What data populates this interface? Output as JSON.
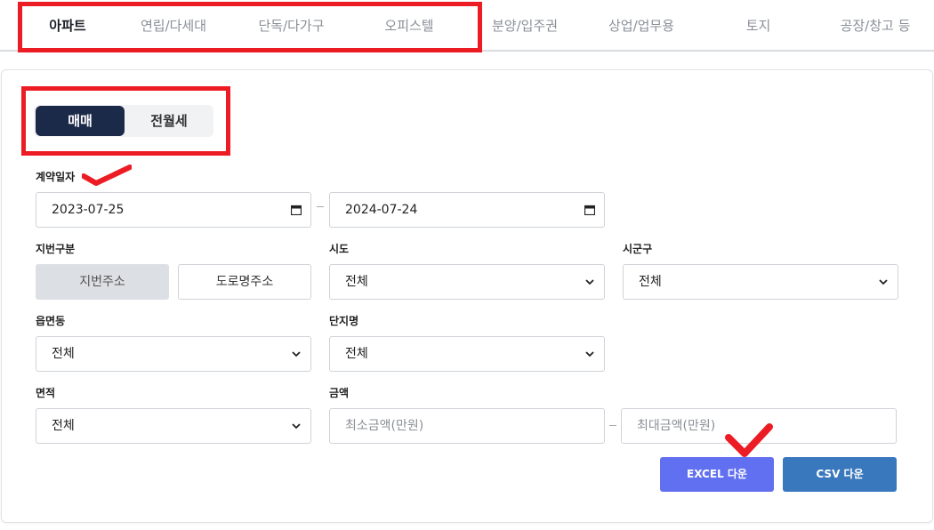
{
  "property_tabs": [
    {
      "label": "아파트",
      "active": true
    },
    {
      "label": "연립/다세대",
      "active": false
    },
    {
      "label": "단독/다가구",
      "active": false
    },
    {
      "label": "오피스텔",
      "active": false
    },
    {
      "label": "분양/입주권",
      "active": false
    },
    {
      "label": "상업/업무용",
      "active": false
    },
    {
      "label": "토지",
      "active": false
    },
    {
      "label": "공장/창고 등",
      "active": false
    }
  ],
  "deal_type": {
    "options": [
      "매매",
      "전월세"
    ],
    "selected": "매매"
  },
  "contract_date": {
    "label": "계약일자",
    "start": "2023-07-25",
    "end": "2024-07-24"
  },
  "lot_type": {
    "label": "지번구분",
    "options": [
      "지번주소",
      "도로명주소"
    ],
    "selected": "지번주소"
  },
  "sido": {
    "label": "시도",
    "value": "전체"
  },
  "sigungu": {
    "label": "시군구",
    "value": "전체"
  },
  "eupmyeondong": {
    "label": "읍면동",
    "value": "전체"
  },
  "complex_name": {
    "label": "단지명",
    "value": "전체"
  },
  "area": {
    "label": "면적",
    "value": "전체"
  },
  "price": {
    "label": "금액",
    "min_placeholder": "최소금액(만원)",
    "max_placeholder": "최대금액(만원)"
  },
  "actions": {
    "excel_label": "EXCEL 다운",
    "csv_label": "CSV 다운"
  },
  "colors": {
    "highlight_red": "#ec1c24",
    "active_navy": "#1c2a4a",
    "excel_button": "#6170f0",
    "csv_button": "#3a78bd"
  },
  "icons": [
    "calendar-icon",
    "chevron-down-icon",
    "checkmark-annotation-icon"
  ]
}
